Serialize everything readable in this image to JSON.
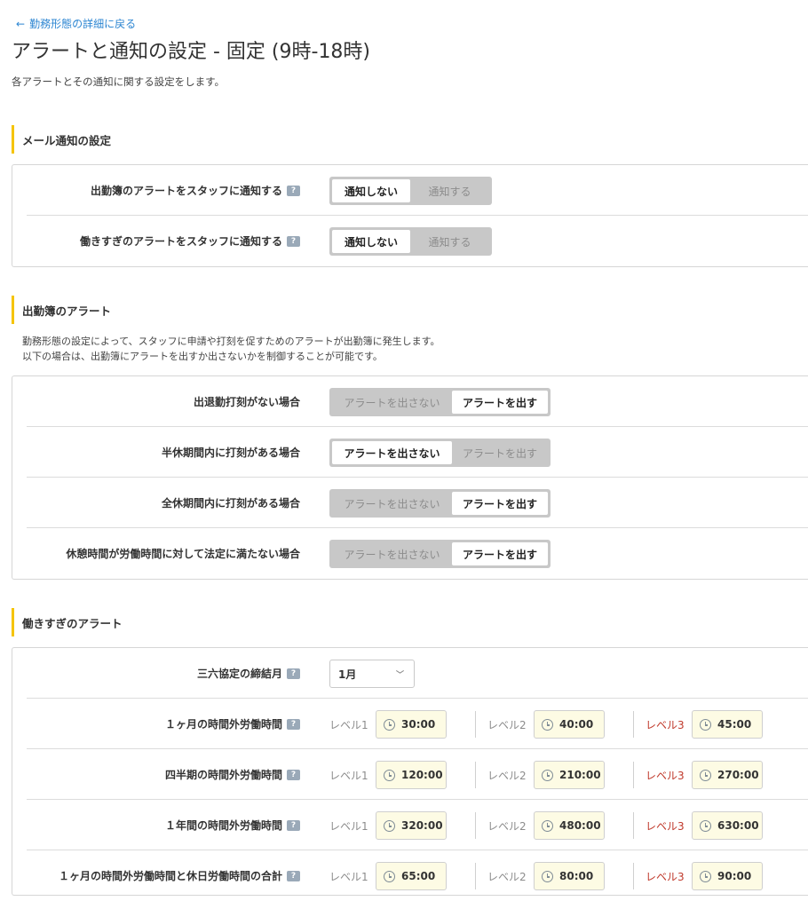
{
  "back_link": "勤務形態の詳細に戻る",
  "title": "アラートと通知の設定 - 固定 (9時-18時)",
  "description": "各アラートとその通知に関する設定をします。",
  "mail_section": {
    "heading": "メール通知の設定",
    "rows": [
      {
        "label": "出勤簿のアラートをスタッフに通知する",
        "options": [
          "通知しない",
          "通知する"
        ],
        "selected": 0
      },
      {
        "label": "働きすぎのアラートをスタッフに通知する",
        "options": [
          "通知しない",
          "通知する"
        ],
        "selected": 0
      }
    ]
  },
  "attendance_section": {
    "heading": "出勤簿のアラート",
    "desc_line1": "勤務形態の設定によって、スタッフに申請や打刻を促すためのアラートが出勤簿に発生します。",
    "desc_line2": "以下の場合は、出勤簿にアラートを出すか出さないかを制御することが可能です。",
    "rows": [
      {
        "label": "出退勤打刻がない場合",
        "options": [
          "アラートを出さない",
          "アラートを出す"
        ],
        "selected": 1
      },
      {
        "label": "半休期間内に打刻がある場合",
        "options": [
          "アラートを出さない",
          "アラートを出す"
        ],
        "selected": 0
      },
      {
        "label": "全休期間内に打刻がある場合",
        "options": [
          "アラートを出さない",
          "アラートを出す"
        ],
        "selected": 1
      },
      {
        "label": "休憩時間が労働時間に対して法定に満たない場合",
        "options": [
          "アラートを出さない",
          "アラートを出す"
        ],
        "selected": 1
      }
    ]
  },
  "overwork_section": {
    "heading": "働きすぎのアラート",
    "closing_month": {
      "label": "三六協定の締結月",
      "value": "1月"
    },
    "level_labels": [
      "レベル1",
      "レベル2",
      "レベル3"
    ],
    "rows": [
      {
        "label": "１ヶ月の時間外労働時間",
        "values": [
          "30:00",
          "40:00",
          "45:00"
        ]
      },
      {
        "label": "四半期の時間外労働時間",
        "values": [
          "120:00",
          "210:00",
          "270:00"
        ]
      },
      {
        "label": "１年間の時間外労働時間",
        "values": [
          "320:00",
          "480:00",
          "630:00"
        ]
      },
      {
        "label": "１ヶ月の時間外労働時間と休日労働時間の合計",
        "values": [
          "65:00",
          "80:00",
          "90:00"
        ]
      }
    ]
  },
  "colors": {
    "accent": "#f5c400",
    "link": "#2d86d2",
    "level3": "#c0392b",
    "time_bg": "#fdfbe4"
  }
}
